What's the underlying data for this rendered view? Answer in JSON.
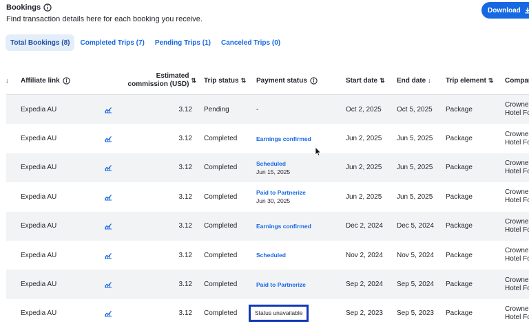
{
  "header": {
    "title": "Bookings",
    "subtitle": "Find transaction details here for each booking you receive."
  },
  "download": {
    "label": "Download"
  },
  "tabs": [
    {
      "label": "Total Bookings (8)",
      "active": true
    },
    {
      "label": "Completed Trips (7)"
    },
    {
      "label": "Pending Trips (1)"
    },
    {
      "label": "Canceled Trips (0)"
    }
  ],
  "columns": {
    "affiliate": "Affiliate link",
    "commission_line1": "Estimated",
    "commission_line2": "commission (USD)",
    "trip_status": "Trip status",
    "payment_status": "Payment status",
    "start_date": "Start date",
    "end_date": "End date",
    "trip_element": "Trip element",
    "company": "Compan"
  },
  "rows": [
    {
      "affiliate": "Expedia AU",
      "commission": "3.12",
      "trip_status": "Pending",
      "payment": "-",
      "payment_sub": "",
      "start": "Oct 2, 2025",
      "end": "Oct 5, 2025",
      "element": "Package",
      "company1": "Crowne",
      "company2": "Hotel Fo"
    },
    {
      "affiliate": "Expedia AU",
      "commission": "3.12",
      "trip_status": "Completed",
      "payment": "Earnings confirmed",
      "payment_sub": "",
      "start": "Jun 2, 2025",
      "end": "Jun 5, 2025",
      "element": "Package",
      "company1": "Crowne",
      "company2": "Hotel Fo"
    },
    {
      "affiliate": "Expedia AU",
      "commission": "3.12",
      "trip_status": "Completed",
      "payment": "Scheduled",
      "payment_sub": "Jun 15, 2025",
      "start": "Jun 2, 2025",
      "end": "Jun 5, 2025",
      "element": "Package",
      "company1": "Crowne",
      "company2": "Hotel Fo"
    },
    {
      "affiliate": "Expedia AU",
      "commission": "3.12",
      "trip_status": "Completed",
      "payment": "Paid to Partnerize",
      "payment_sub": "Jun 30, 2025",
      "start": "Jun 2, 2025",
      "end": "Jun 5, 2025",
      "element": "Package",
      "company1": "Crowne",
      "company2": "Hotel Fo"
    },
    {
      "affiliate": "Expedia AU",
      "commission": "3.12",
      "trip_status": "Completed",
      "payment": "Earnings confirmed",
      "payment_sub": "",
      "start": "Dec 2, 2024",
      "end": "Dec 5, 2024",
      "element": "Package",
      "company1": "Crowne",
      "company2": "Hotel Fo"
    },
    {
      "affiliate": "Expedia AU",
      "commission": "3.12",
      "trip_status": "Completed",
      "payment": "Scheduled",
      "payment_sub": "",
      "start": "Nov 2, 2024",
      "end": "Nov 5, 2024",
      "element": "Package",
      "company1": "Crowne",
      "company2": "Hotel Fo"
    },
    {
      "affiliate": "Expedia AU",
      "commission": "3.12",
      "trip_status": "Completed",
      "payment": "Paid to Partnerize",
      "payment_sub": "",
      "start": "Sep 2, 2024",
      "end": "Sep 5, 2024",
      "element": "Package",
      "company1": "Crowne",
      "company2": "Hotel Fo"
    },
    {
      "affiliate": "Expedia AU",
      "commission": "3.12",
      "trip_status": "Completed",
      "payment": "Status unavailable",
      "payment_sub": "",
      "start": "Sep 2, 2023",
      "end": "Sep 5, 2023",
      "element": "Package",
      "company1": "Crowne",
      "company2": "Hotel Fo"
    }
  ],
  "colors": {
    "accent": "#1668e3",
    "highlight": "#1237b8",
    "row_shade": "#f2f3f5"
  }
}
